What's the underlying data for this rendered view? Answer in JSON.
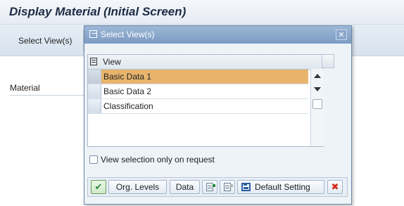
{
  "screen": {
    "title": "Display Material (Initial Screen)",
    "toolbar_button": "Select View(s)",
    "material_label": "Material"
  },
  "dialog": {
    "title": "Select View(s)",
    "close_icon": "close-icon",
    "table": {
      "column_header": "View",
      "rows": [
        {
          "label": "Basic Data 1",
          "selected": true
        },
        {
          "label": "Basic Data 2",
          "selected": false
        },
        {
          "label": "Classification",
          "selected": false
        }
      ]
    },
    "checkbox": {
      "label": "View selection only on request",
      "checked": false
    },
    "buttons": {
      "ok": "ok-check-icon",
      "org_levels": "Org. Levels",
      "data": "Data",
      "select_all": "select-all-icon",
      "deselect_all": "deselect-all-icon",
      "default_setting": "Default Setting",
      "cancel": "cancel-x-icon"
    }
  },
  "colors": {
    "selected_row": "#e8b46c",
    "dialog_header": "#7b9bc3",
    "ok_green": "#2e8b3d",
    "cancel_red": "#d12b1b"
  }
}
